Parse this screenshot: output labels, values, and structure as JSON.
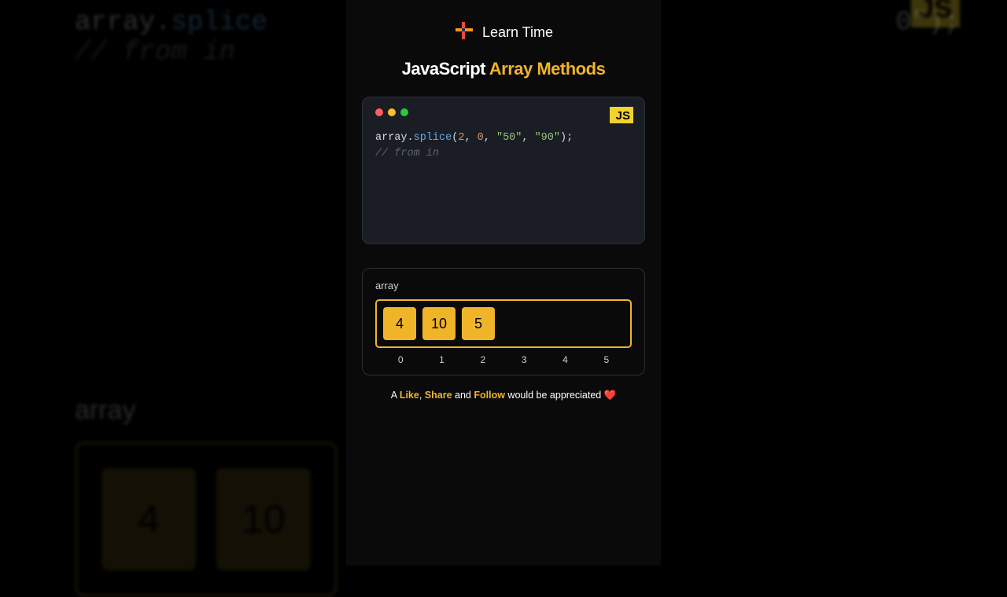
{
  "brand": "Learn Time",
  "title_part1": "JavaScript ",
  "title_part2": "Array Methods",
  "js_badge": "JS",
  "code": {
    "obj": "array",
    "method": "splice",
    "args_open": "(",
    "arg1": "2",
    "sep": ", ",
    "arg2": "0",
    "arg3": "\"50\"",
    "arg4": "\"90\"",
    "args_close": ");",
    "comment": "// from in"
  },
  "vis": {
    "label": "array",
    "cells": [
      "4",
      "10",
      "5"
    ],
    "indices": [
      "0",
      "1",
      "2",
      "3",
      "4",
      "5"
    ]
  },
  "footer": {
    "pre": "A ",
    "like": "Like",
    "sep1": ", ",
    "share": "Share",
    "sep2": " and ",
    "follow": "Follow",
    "post": " would be appreciated ",
    "heart": "❤️"
  },
  "bg": {
    "code_right": "0\");",
    "array_label": "array",
    "cells": [
      "4",
      "10"
    ]
  }
}
